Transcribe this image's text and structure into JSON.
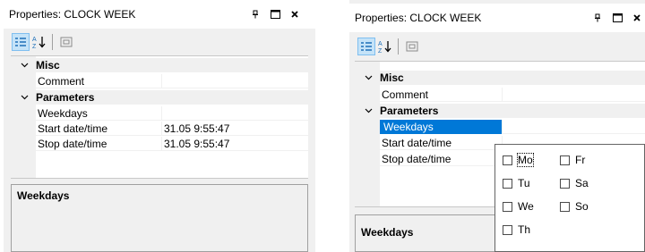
{
  "left_panel": {
    "title": "Properties: CLOCK WEEK",
    "categories": [
      {
        "label": "Misc",
        "properties": [
          {
            "name": "Comment",
            "value": ""
          }
        ]
      },
      {
        "label": "Parameters",
        "properties": [
          {
            "name": "Weekdays",
            "value": ""
          },
          {
            "name": "Start date/time",
            "value": "31.05 9:55:47"
          },
          {
            "name": "Stop date/time",
            "value": "31.05 9:55:47"
          }
        ]
      }
    ],
    "description_title": "Weekdays"
  },
  "right_panel": {
    "title": "Properties: CLOCK WEEK",
    "categories": [
      {
        "label": "Misc",
        "properties": [
          {
            "name": "Comment",
            "value": ""
          }
        ]
      },
      {
        "label": "Parameters",
        "properties": [
          {
            "name": "Weekdays",
            "value": ""
          },
          {
            "name": "Start date/time",
            "value": ""
          },
          {
            "name": "Stop date/time",
            "value": ""
          }
        ]
      }
    ],
    "description_title": "Weekdays",
    "weekday_options": [
      {
        "label": "Mo",
        "checked": false
      },
      {
        "label": "Tu",
        "checked": false
      },
      {
        "label": "We",
        "checked": false
      },
      {
        "label": "Th",
        "checked": false
      },
      {
        "label": "Fr",
        "checked": false
      },
      {
        "label": "Sa",
        "checked": false
      },
      {
        "label": "So",
        "checked": false
      }
    ]
  },
  "icons": [
    "pin-icon",
    "maximize-icon",
    "close-icon",
    "categorized-icon",
    "sort-alpha-icon",
    "property-pages-icon",
    "chevron-down-icon",
    "dropdown-arrow-icon"
  ],
  "colors": {
    "selection": "#0078d7",
    "toolbar_active": "#c5e3f8",
    "panel_bg": "#f0f0f0"
  }
}
